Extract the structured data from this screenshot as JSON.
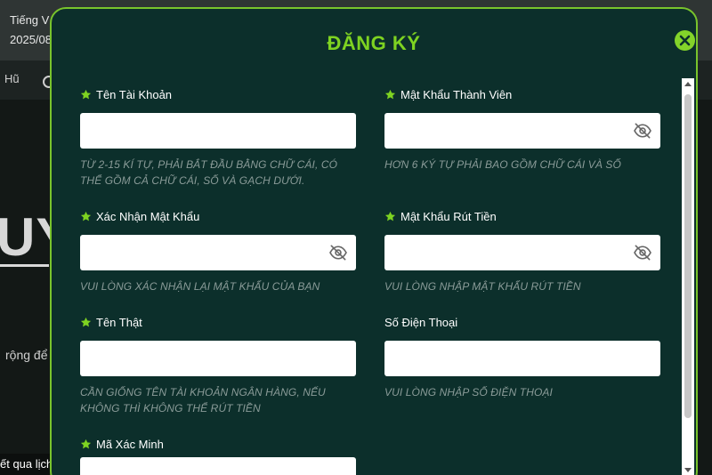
{
  "background": {
    "language": "Tiếng V",
    "date": "2025/08",
    "nav_item": "Hũ",
    "big_text": "UY",
    "body_text": "rộng để",
    "bottom_link": "ết qua lịch sử"
  },
  "modal": {
    "title": "ĐĂNG KÝ",
    "fields": {
      "username": {
        "label": "Tên Tài Khoản",
        "value": "",
        "hint": "TỪ 2-15 KÍ TỰ, PHẢI BẮT ĐẦU BẰNG CHỮ CÁI, CÓ THỂ GỒM CẢ CHỮ CÁI, SỐ VÀ GẠCH DƯỚI."
      },
      "password": {
        "label": "Mật Khẩu Thành Viên",
        "value": "",
        "hint": "HƠN 6 KÝ TỰ PHẢI BAO GỒM CHỮ CÁI VÀ SỐ"
      },
      "confirm_password": {
        "label": "Xác Nhận Mật Khẩu",
        "value": "",
        "hint": "VUI LÒNG XÁC NHẬN LẠI MẬT KHẨU CỦA BẠN"
      },
      "withdraw_password": {
        "label": "Mật Khẩu Rút Tiền",
        "value": "",
        "hint": "VUI LÒNG NHẬP MẬT KHẨU RÚT TIỀN"
      },
      "real_name": {
        "label": "Tên Thật",
        "value": "",
        "hint": "CẦN GIỐNG TÊN TÀI KHOẢN NGÂN HÀNG, NẾU KHÔNG THÌ KHÔNG THỂ RÚT TIỀN"
      },
      "phone": {
        "label": "Số Điện Thoại",
        "value": "",
        "hint": "VUI LÒNG NHẬP SỐ ĐIỆN THOẠI"
      },
      "verify_code": {
        "label": "Mã Xác Minh",
        "value": ""
      }
    }
  },
  "colors": {
    "accent": "#7ed321",
    "modal_bg": "#0c2f2b",
    "hint_text": "#8a9b98"
  },
  "icons": [
    "star-icon",
    "eye-slash-icon",
    "close-icon"
  ]
}
